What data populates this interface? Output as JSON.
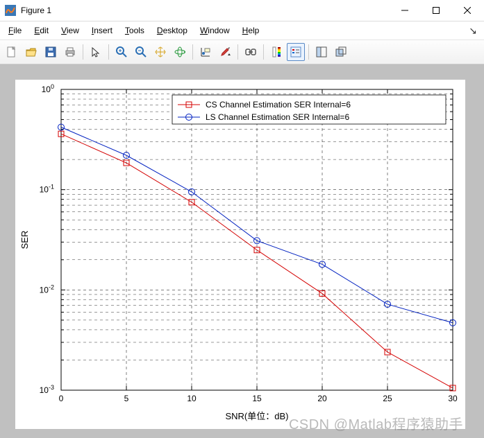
{
  "window": {
    "title": "Figure 1"
  },
  "menus": {
    "file": {
      "u": "F",
      "rest": "ile"
    },
    "edit": {
      "u": "E",
      "rest": "dit"
    },
    "view": {
      "u": "V",
      "rest": "iew"
    },
    "insert": {
      "u": "I",
      "rest": "nsert"
    },
    "tools": {
      "u": "T",
      "rest": "ools"
    },
    "desktop": {
      "u": "D",
      "rest": "esktop"
    },
    "window": {
      "u": "W",
      "rest": "indow"
    },
    "help": {
      "u": "H",
      "rest": "elp"
    }
  },
  "toolbar_icons": [
    "new-file-icon",
    "open-file-icon",
    "save-icon",
    "print-icon",
    "sep",
    "pointer-icon",
    "sep",
    "zoom-in-icon",
    "zoom-out-icon",
    "pan-icon",
    "rotate3d-icon",
    "sep",
    "datatip-icon",
    "brush-icon",
    "sep",
    "link-icon",
    "sep",
    "colorbar-icon",
    "legend-icon",
    "sep",
    "dock-icon",
    "undock-icon"
  ],
  "watermark": "CSDN @Matlab程序猿助手",
  "chart_data": {
    "type": "line",
    "xlabel": "SNR(单位：dB)",
    "ylabel": "SER",
    "x": [
      0,
      5,
      10,
      15,
      20,
      25,
      30
    ],
    "xlim": [
      0,
      30
    ],
    "ylim_log10": [
      -3,
      0
    ],
    "yticks_log10": [
      0,
      -1,
      -2,
      -3
    ],
    "grid": true,
    "legend_pos": "top-right-inset",
    "series": [
      {
        "name": "CS Channel Estimation SER Internal=6",
        "color": "#d40000",
        "marker": "square",
        "values": [
          0.36,
          0.185,
          0.075,
          0.025,
          0.0092,
          0.0024,
          0.00105
        ]
      },
      {
        "name": "LS Channel Estimation SER Internal=6",
        "color": "#0020c0",
        "marker": "circle",
        "values": [
          0.42,
          0.22,
          0.095,
          0.031,
          0.018,
          0.0072,
          0.0047
        ]
      }
    ]
  }
}
